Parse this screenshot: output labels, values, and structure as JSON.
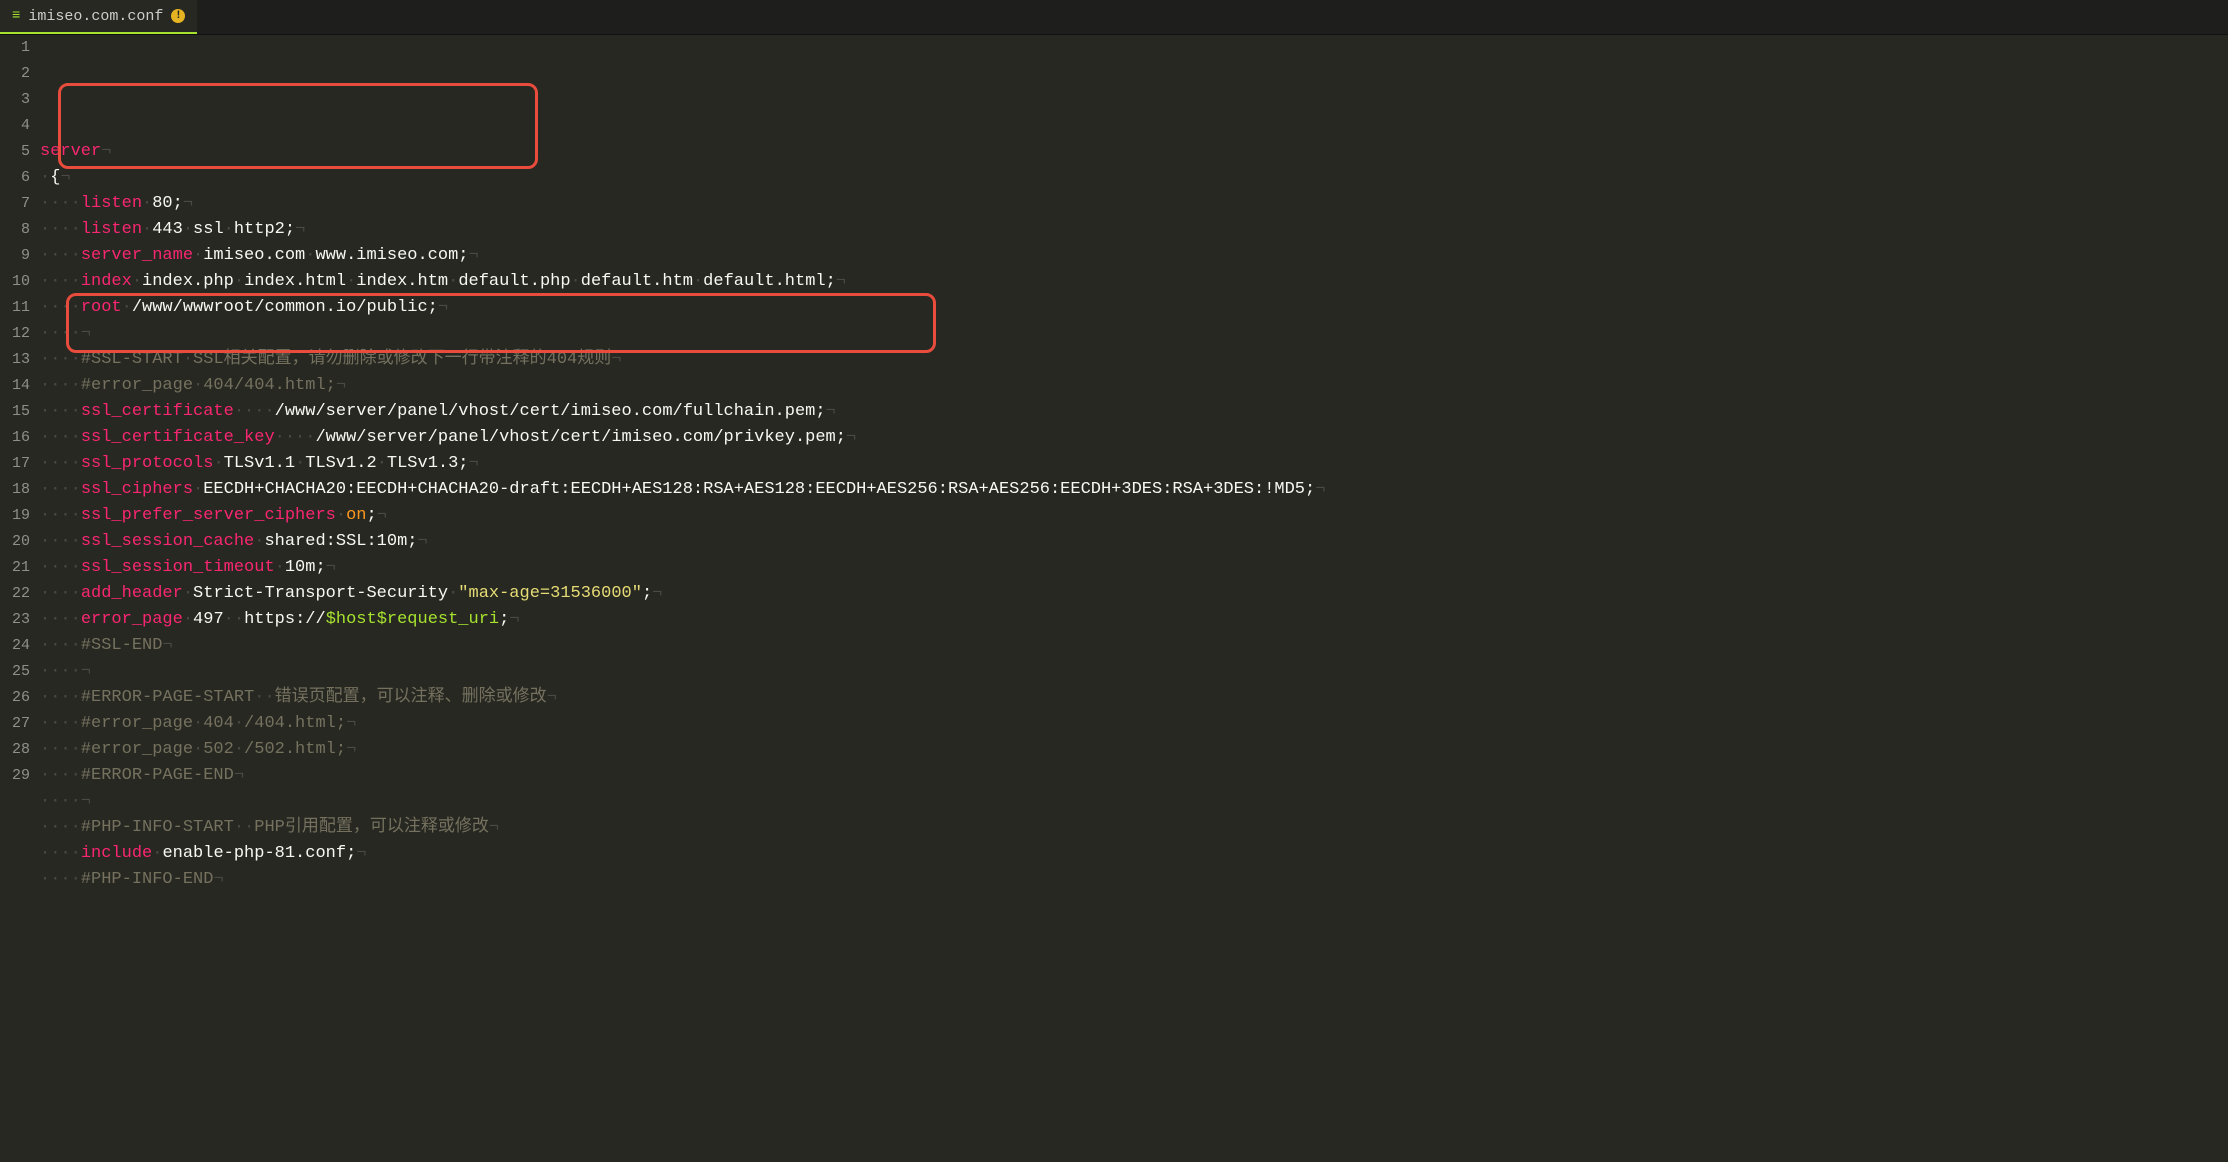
{
  "tab": {
    "filename": "imiseo.com.conf",
    "modified_indicator": "!"
  },
  "lines": [
    {
      "num": 1,
      "tokens": [
        [
          "kw",
          "server"
        ],
        [
          "invis",
          "¬"
        ]
      ]
    },
    {
      "num": 2,
      "tokens": [
        [
          "invis",
          "·"
        ],
        [
          "white",
          "{"
        ],
        [
          "invis",
          "¬"
        ]
      ]
    },
    {
      "num": 3,
      "tokens": [
        [
          "invis",
          "····"
        ],
        [
          "kw",
          "listen"
        ],
        [
          "invis",
          "·"
        ],
        [
          "white",
          "80;"
        ],
        [
          "invis",
          "¬"
        ]
      ]
    },
    {
      "num": 4,
      "tokens": [
        [
          "invis",
          "····"
        ],
        [
          "kw",
          "listen"
        ],
        [
          "invis",
          "·"
        ],
        [
          "white",
          "443"
        ],
        [
          "invis",
          "·"
        ],
        [
          "white",
          "ssl"
        ],
        [
          "invis",
          "·"
        ],
        [
          "white",
          "http2;"
        ],
        [
          "invis",
          "¬"
        ]
      ]
    },
    {
      "num": 5,
      "tokens": [
        [
          "invis",
          "····"
        ],
        [
          "kw",
          "server_name"
        ],
        [
          "invis",
          "·"
        ],
        [
          "white",
          "imiseo.com"
        ],
        [
          "invis",
          "·"
        ],
        [
          "white",
          "www.imiseo.com;"
        ],
        [
          "invis",
          "¬"
        ]
      ]
    },
    {
      "num": 6,
      "tokens": [
        [
          "invis",
          "····"
        ],
        [
          "kw",
          "index"
        ],
        [
          "invis",
          "·"
        ],
        [
          "white",
          "index.php"
        ],
        [
          "invis",
          "·"
        ],
        [
          "white",
          "index.html"
        ],
        [
          "invis",
          "·"
        ],
        [
          "white",
          "index.htm"
        ],
        [
          "invis",
          "·"
        ],
        [
          "white",
          "default.php"
        ],
        [
          "invis",
          "·"
        ],
        [
          "white",
          "default.htm"
        ],
        [
          "invis",
          "·"
        ],
        [
          "white",
          "default.html;"
        ],
        [
          "invis",
          "¬"
        ]
      ]
    },
    {
      "num": 7,
      "tokens": [
        [
          "invis",
          "····"
        ],
        [
          "kw",
          "root"
        ],
        [
          "invis",
          "·"
        ],
        [
          "white",
          "/www/wwwroot/common.io/public;"
        ],
        [
          "invis",
          "¬"
        ]
      ]
    },
    {
      "num": 8,
      "tokens": [
        [
          "invis",
          "····¬"
        ]
      ]
    },
    {
      "num": 9,
      "tokens": [
        [
          "invis",
          "····"
        ],
        [
          "comment",
          "#SSL-START"
        ],
        [
          "invis",
          "·"
        ],
        [
          "comment",
          "SSL相关配置，请勿删除或修改下一行带注释的404规则"
        ],
        [
          "invis",
          "¬"
        ]
      ]
    },
    {
      "num": 10,
      "tokens": [
        [
          "invis",
          "····"
        ],
        [
          "comment",
          "#error_page"
        ],
        [
          "invis",
          "·"
        ],
        [
          "comment",
          "404/404.html;"
        ],
        [
          "invis",
          "¬"
        ]
      ]
    },
    {
      "num": 11,
      "tokens": [
        [
          "invis",
          "····"
        ],
        [
          "kw",
          "ssl_certificate"
        ],
        [
          "invis",
          "····"
        ],
        [
          "white",
          "/www/server/panel/vhost/cert/imiseo.com/fullchain.pem;"
        ],
        [
          "invis",
          "¬"
        ]
      ]
    },
    {
      "num": 12,
      "tokens": [
        [
          "invis",
          "····"
        ],
        [
          "kw",
          "ssl_certificate_key"
        ],
        [
          "invis",
          "····"
        ],
        [
          "white",
          "/www/server/panel/vhost/cert/imiseo.com/privkey.pem;"
        ],
        [
          "invis",
          "¬"
        ]
      ]
    },
    {
      "num": 13,
      "tokens": [
        [
          "invis",
          "····"
        ],
        [
          "kw",
          "ssl_protocols"
        ],
        [
          "invis",
          "·"
        ],
        [
          "white",
          "TLSv1.1"
        ],
        [
          "invis",
          "·"
        ],
        [
          "white",
          "TLSv1.2"
        ],
        [
          "invis",
          "·"
        ],
        [
          "white",
          "TLSv1.3;"
        ],
        [
          "invis",
          "¬"
        ]
      ]
    },
    {
      "num": 14,
      "tokens": [
        [
          "invis",
          "····"
        ],
        [
          "kw",
          "ssl_ciphers"
        ],
        [
          "invis",
          "·"
        ],
        [
          "white",
          "EECDH+CHACHA20:EECDH+CHACHA20-draft:EECDH+AES128:RSA+AES128:EECDH+AES256:RSA+AES256:EECDH+3DES:RSA+3DES:!MD5;"
        ],
        [
          "invis",
          "¬"
        ]
      ]
    },
    {
      "num": 15,
      "tokens": [
        [
          "invis",
          "····"
        ],
        [
          "kw",
          "ssl_prefer_server_ciphers"
        ],
        [
          "invis",
          "·"
        ],
        [
          "param",
          "on"
        ],
        [
          "white",
          ";"
        ],
        [
          "invis",
          "¬"
        ]
      ]
    },
    {
      "num": 16,
      "tokens": [
        [
          "invis",
          "····"
        ],
        [
          "kw",
          "ssl_session_cache"
        ],
        [
          "invis",
          "·"
        ],
        [
          "white",
          "shared:SSL:10m;"
        ],
        [
          "invis",
          "¬"
        ]
      ]
    },
    {
      "num": 17,
      "tokens": [
        [
          "invis",
          "····"
        ],
        [
          "kw",
          "ssl_session_timeout"
        ],
        [
          "invis",
          "·"
        ],
        [
          "white",
          "10m;"
        ],
        [
          "invis",
          "¬"
        ]
      ]
    },
    {
      "num": 18,
      "tokens": [
        [
          "invis",
          "····"
        ],
        [
          "kw",
          "add_header"
        ],
        [
          "invis",
          "·"
        ],
        [
          "white",
          "Strict-Transport-Security"
        ],
        [
          "invis",
          "·"
        ],
        [
          "str",
          "\"max-age=31536000\""
        ],
        [
          "white",
          ";"
        ],
        [
          "invis",
          "¬"
        ]
      ]
    },
    {
      "num": 19,
      "tokens": [
        [
          "invis",
          "····"
        ],
        [
          "kw",
          "error_page"
        ],
        [
          "invis",
          "·"
        ],
        [
          "white",
          "497"
        ],
        [
          "invis",
          "··"
        ],
        [
          "white",
          "https://"
        ],
        [
          "green",
          "$host$request_uri"
        ],
        [
          "white",
          ";"
        ],
        [
          "invis",
          "¬"
        ]
      ]
    },
    {
      "num": 20,
      "tokens": [
        [
          "invis",
          "····"
        ],
        [
          "comment",
          "#SSL-END"
        ],
        [
          "invis",
          "¬"
        ]
      ]
    },
    {
      "num": 21,
      "tokens": [
        [
          "invis",
          "····¬"
        ]
      ]
    },
    {
      "num": 22,
      "tokens": [
        [
          "invis",
          "····"
        ],
        [
          "comment",
          "#ERROR-PAGE-START"
        ],
        [
          "invis",
          "··"
        ],
        [
          "comment",
          "错误页配置，可以注释、删除或修改"
        ],
        [
          "invis",
          "¬"
        ]
      ]
    },
    {
      "num": 23,
      "tokens": [
        [
          "invis",
          "····"
        ],
        [
          "comment",
          "#error_page"
        ],
        [
          "invis",
          "·"
        ],
        [
          "comment",
          "404"
        ],
        [
          "invis",
          "·"
        ],
        [
          "comment",
          "/404.html;"
        ],
        [
          "invis",
          "¬"
        ]
      ]
    },
    {
      "num": 24,
      "tokens": [
        [
          "invis",
          "····"
        ],
        [
          "comment",
          "#error_page"
        ],
        [
          "invis",
          "·"
        ],
        [
          "comment",
          "502"
        ],
        [
          "invis",
          "·"
        ],
        [
          "comment",
          "/502.html;"
        ],
        [
          "invis",
          "¬"
        ]
      ]
    },
    {
      "num": 25,
      "tokens": [
        [
          "invis",
          "····"
        ],
        [
          "comment",
          "#ERROR-PAGE-END"
        ],
        [
          "invis",
          "¬"
        ]
      ]
    },
    {
      "num": 26,
      "tokens": [
        [
          "invis",
          "····¬"
        ]
      ]
    },
    {
      "num": 27,
      "tokens": [
        [
          "invis",
          "····"
        ],
        [
          "comment",
          "#PHP-INFO-START"
        ],
        [
          "invis",
          "··"
        ],
        [
          "comment",
          "PHP引用配置，可以注释或修改"
        ],
        [
          "invis",
          "¬"
        ]
      ]
    },
    {
      "num": 28,
      "tokens": [
        [
          "invis",
          "····"
        ],
        [
          "kw",
          "include"
        ],
        [
          "invis",
          "·"
        ],
        [
          "white",
          "enable-php-81.conf;"
        ],
        [
          "invis",
          "¬"
        ]
      ]
    },
    {
      "num": 29,
      "tokens": [
        [
          "invis",
          "····"
        ],
        [
          "comment",
          "#PHP-INFO-END"
        ],
        [
          "invis",
          "¬"
        ]
      ]
    }
  ]
}
